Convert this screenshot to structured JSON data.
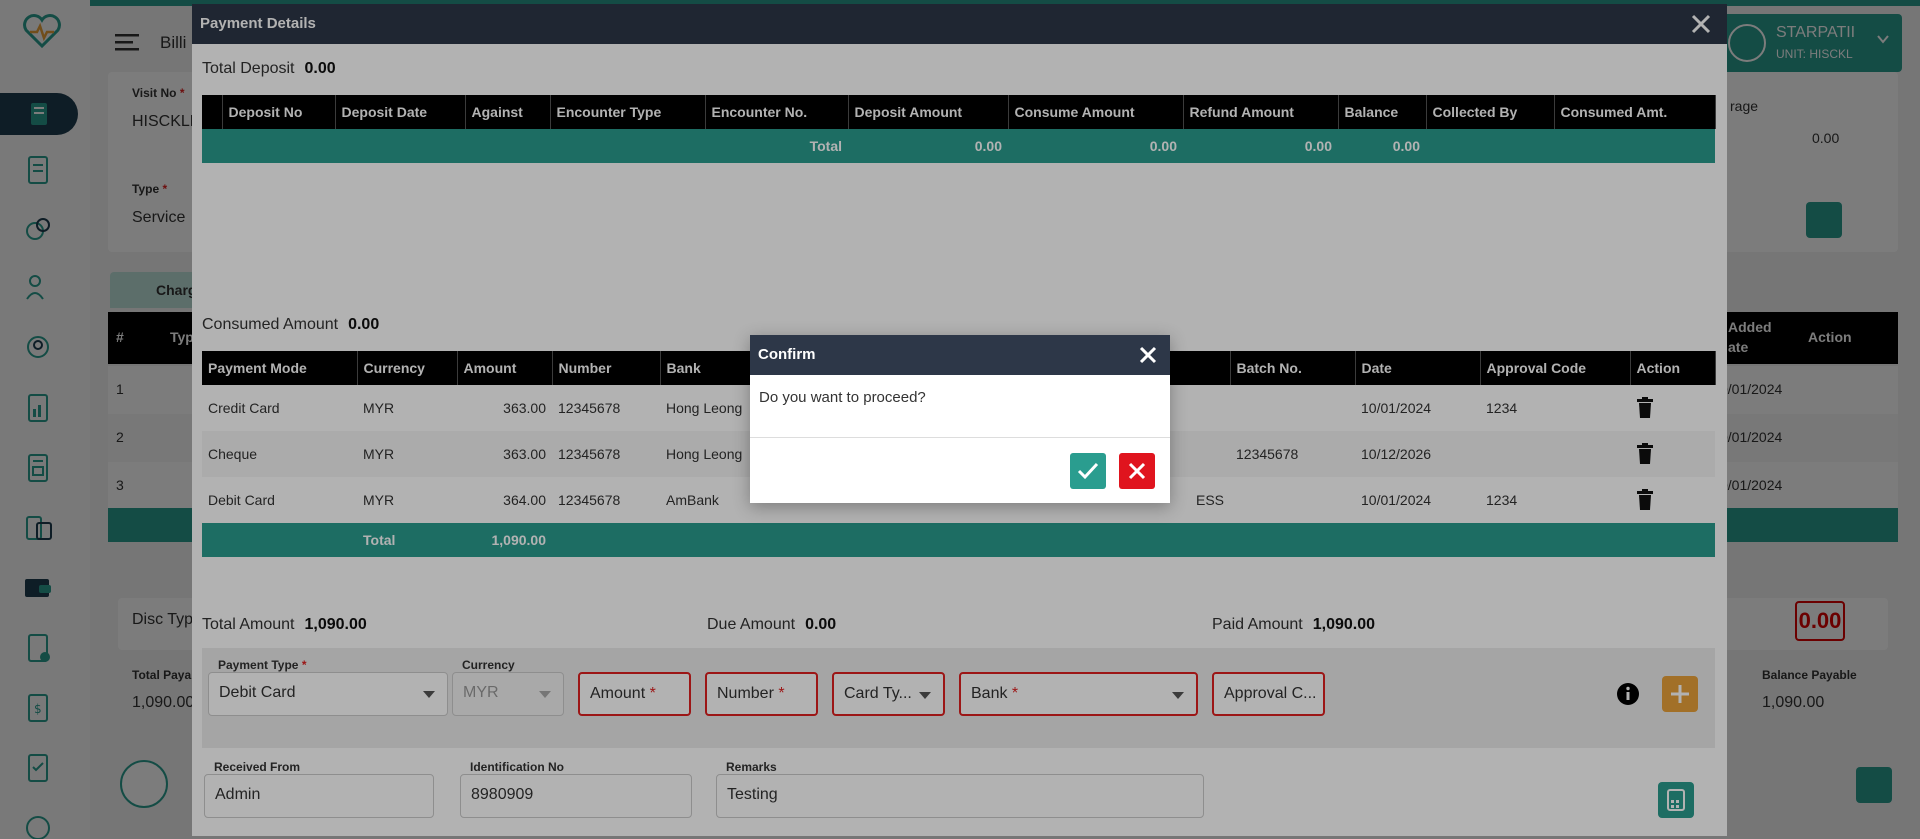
{
  "background": {
    "page_title": "Billi",
    "user": {
      "name": "STARPATII",
      "unit": "UNIT: HISCKL"
    },
    "visit_no_label": "Visit No",
    "visit_no_value": "HISCKLE",
    "type_label": "Type",
    "type_value": "Service",
    "tab_label": "Charg",
    "table_cols": {
      "hash": "#",
      "typ": "Typ",
      "added_date": "Added\nate",
      "action": "Action",
      "age": "rage"
    },
    "rows": [
      {
        "index": "1",
        "date": "0/01/2024"
      },
      {
        "index": "2",
        "date": "0/01/2024"
      },
      {
        "index": "3",
        "date": "0/01/2024"
      }
    ],
    "right_value": "0.00",
    "disc_label": "Disc Typ",
    "total_payable_label": "Total Payab",
    "total_payable_value": "1,090.00",
    "balance_payable_label": "Balance Payable",
    "balance_payable_value": "1,090.00",
    "due_value": "0.00"
  },
  "modal": {
    "title": "Payment Details",
    "total_deposit_label": "Total Deposit",
    "total_deposit_value": "0.00",
    "deposit_table": {
      "headers": [
        "Deposit No",
        "Deposit Date",
        "Against",
        "Encounter Type",
        "Encounter No.",
        "Deposit Amount",
        "Consume Amount",
        "Refund Amount",
        "Balance",
        "Collected By",
        "Consumed Amt."
      ],
      "total_label": "Total",
      "totals": {
        "deposit_amount": "0.00",
        "consume_amount": "0.00",
        "refund_amount": "0.00",
        "balance": "0.00"
      }
    },
    "consumed_amount_label": "Consumed Amount",
    "consumed_amount_value": "0.00",
    "payment_table": {
      "headers": [
        "Payment Mode",
        "Currency",
        "Amount",
        "Number",
        "Bank",
        "",
        "Batch No.",
        "Date",
        "Approval Code",
        "Action"
      ],
      "rows": [
        {
          "mode": "Credit Card",
          "currency": "MYR",
          "amount": "363.00",
          "number": "12345678",
          "bank": "Hong Leong",
          "extra": "",
          "batch": "",
          "date": "10/01/2024",
          "approval": "1234"
        },
        {
          "mode": "Cheque",
          "currency": "MYR",
          "amount": "363.00",
          "number": "12345678",
          "bank": "Hong Leong",
          "extra": "",
          "batch": "12345678",
          "date": "10/12/2026",
          "approval": ""
        },
        {
          "mode": "Debit Card",
          "currency": "MYR",
          "amount": "364.00",
          "number": "12345678",
          "bank": "AmBank",
          "extra": "ESS",
          "batch": "",
          "date": "10/01/2024",
          "approval": "1234"
        }
      ],
      "total_label": "Total",
      "total_amount": "1,090.00"
    },
    "total_amount_label": "Total Amount",
    "total_amount_value": "1,090.00",
    "due_amount_label": "Due Amount",
    "due_amount_value": "0.00",
    "paid_amount_label": "Paid Amount",
    "paid_amount_value": "1,090.00",
    "form": {
      "payment_type_label": "Payment Type",
      "payment_type_value": "Debit Card",
      "currency_label": "Currency",
      "currency_value": "MYR",
      "amount_placeholder": "Amount",
      "number_placeholder": "Number",
      "card_type_placeholder": "Card Ty...",
      "bank_placeholder": "Bank",
      "approval_placeholder": "Approval C...",
      "received_from_label": "Received From",
      "received_from_value": "Admin",
      "identification_label": "Identification No",
      "identification_value": "8980909",
      "remarks_label": "Remarks",
      "remarks_value": "Testing"
    }
  },
  "confirm": {
    "title": "Confirm",
    "message": "Do you want to proceed?"
  },
  "colors": {
    "teal": "#2a9d8f",
    "header": "#2d3748",
    "danger": "#e0141e",
    "accent_orange": "#e8a13a"
  }
}
